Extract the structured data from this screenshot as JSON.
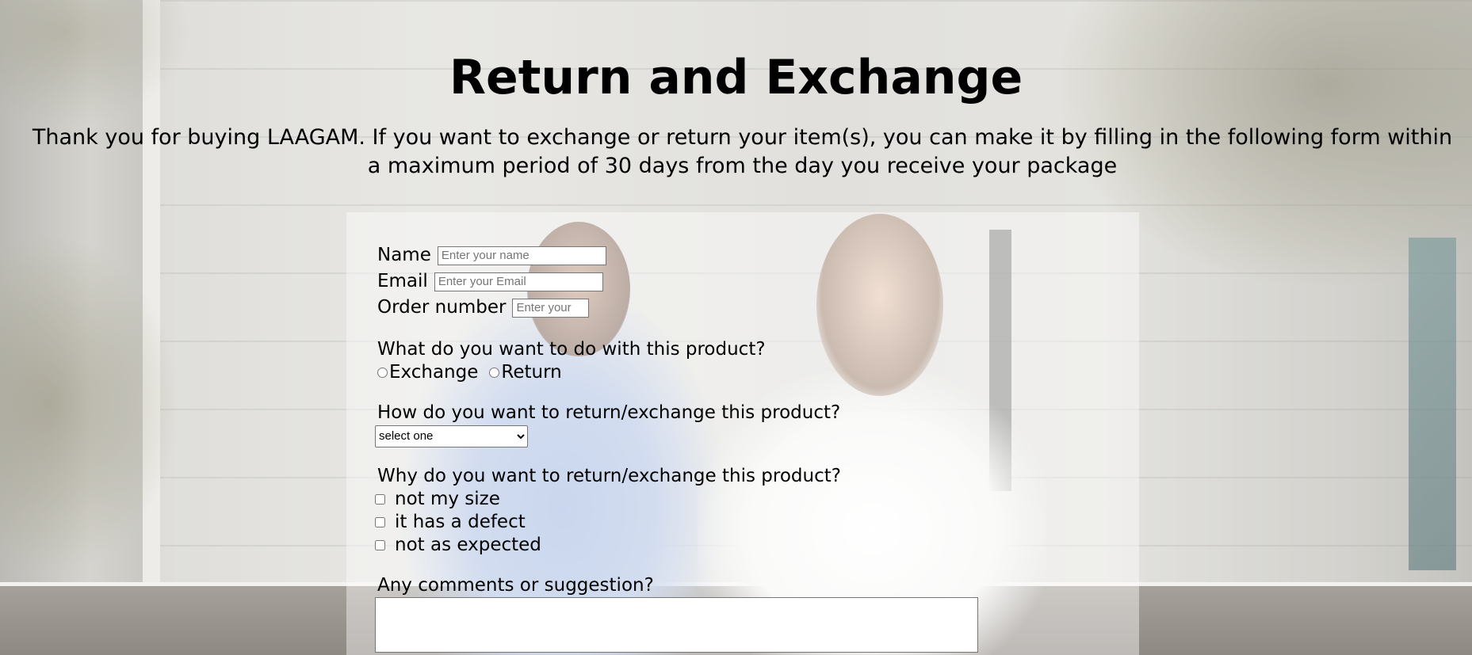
{
  "page": {
    "title": "Return and Exchange",
    "intro": "Thank you for buying LAAGAM. If you want to exchange or return your item(s), you can make it by filling in the following form within a maximum period of 30 days from the day you receive your package"
  },
  "form": {
    "name": {
      "label": "Name",
      "placeholder": "Enter your name",
      "value": ""
    },
    "email": {
      "label": "Email",
      "placeholder": "Enter your Email",
      "value": ""
    },
    "order": {
      "label": "Order number",
      "placeholder": "Enter your",
      "value": ""
    },
    "action": {
      "question": "What do you want to do with this product?",
      "options": [
        "Exchange",
        "Return"
      ]
    },
    "method": {
      "question": "How do you want to return/exchange this product?",
      "selected": "select one"
    },
    "reason": {
      "question": "Why do you want to return/exchange this product?",
      "options": [
        "not my size",
        "it has a defect",
        "not as expected"
      ]
    },
    "comments": {
      "question": "Any comments or suggestion?",
      "value": ""
    }
  },
  "colors": {
    "text": "#000000",
    "panel": "rgba(255,255,255,0.42)"
  }
}
